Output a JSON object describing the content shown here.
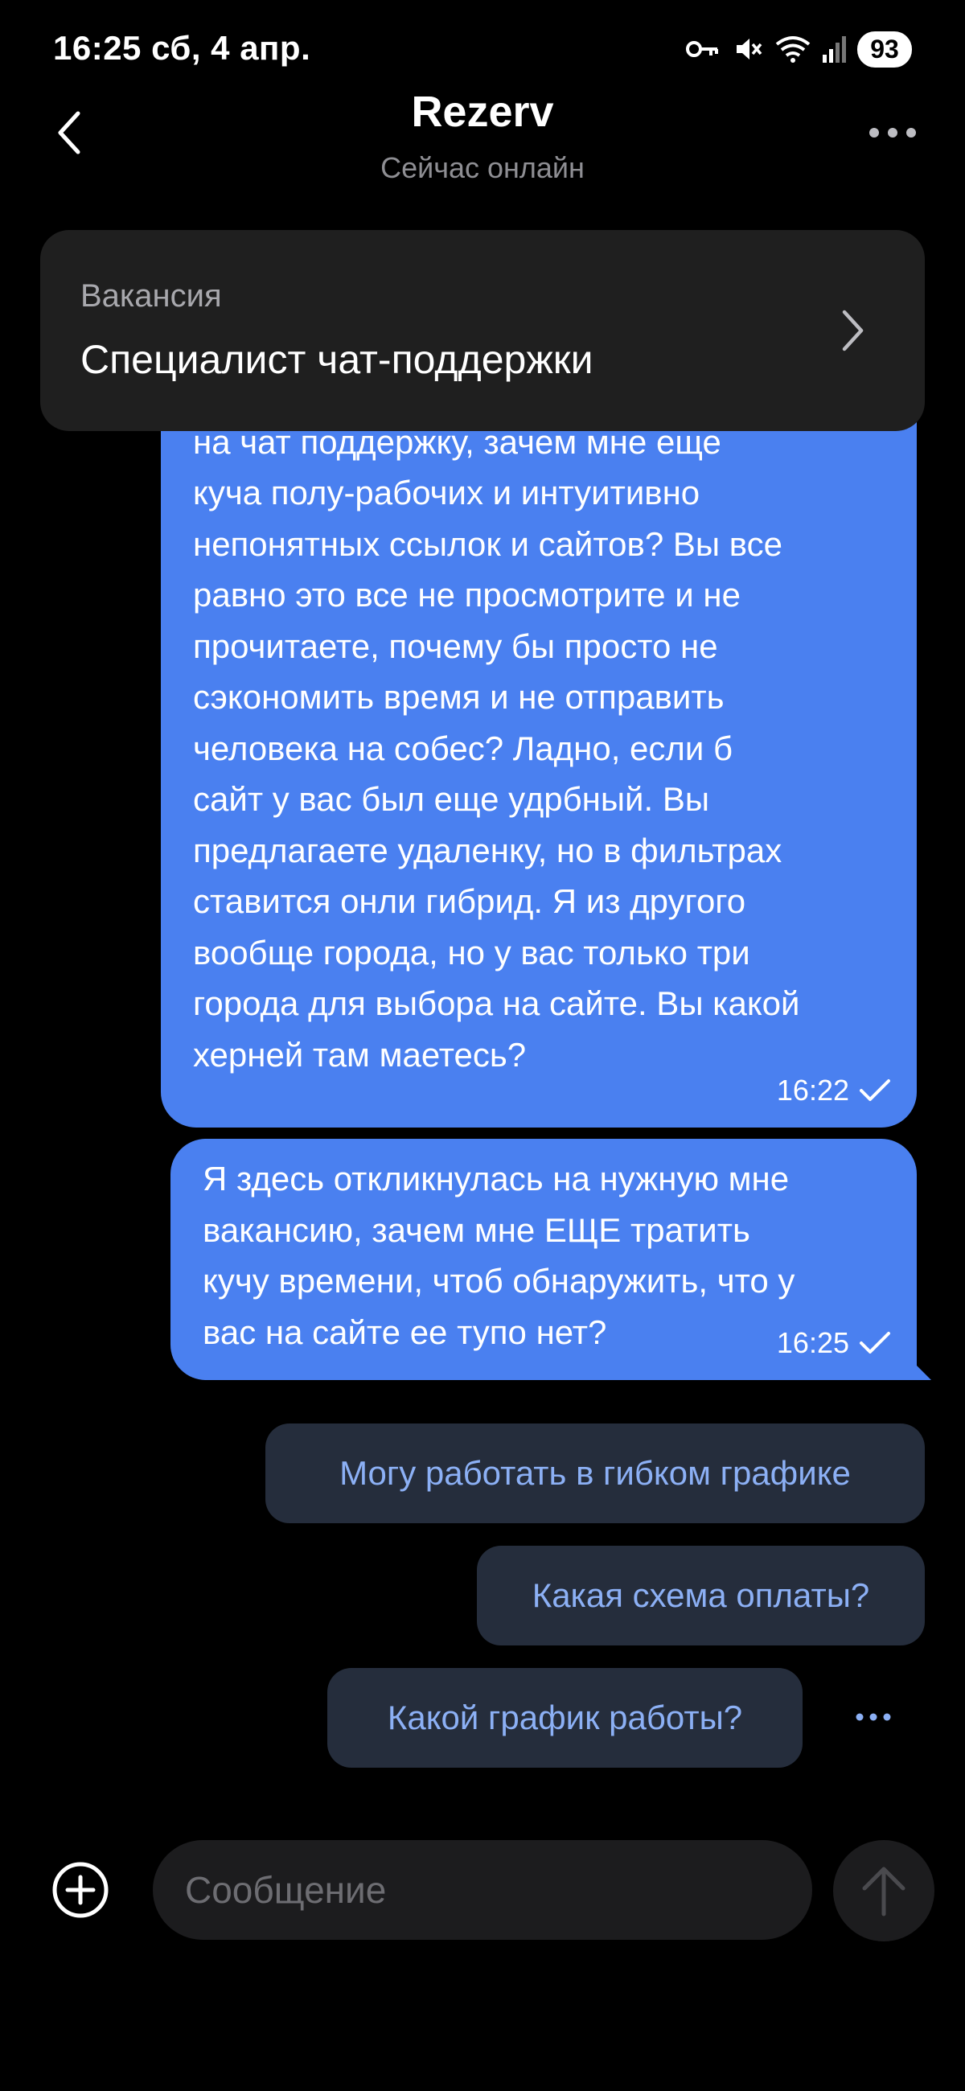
{
  "status_bar": {
    "time_date": "16:25  сб, 4 апр.",
    "battery": "93",
    "icons": [
      "key-icon",
      "mute-icon",
      "wifi-icon",
      "signal-icon",
      "battery-icon"
    ]
  },
  "header": {
    "title": "Rezerv",
    "status": "Сейчас онлайн",
    "back_icon": "chevron-left-icon",
    "more_icon": "more-horizontal-icon"
  },
  "vacancy": {
    "label": "Вакансия",
    "title": "Специалист чат-поддержки",
    "chevron_icon": "chevron-right-icon"
  },
  "messages": [
    {
      "text": "Непрофильное это все. Я откликнулась\nна чат поддержку, зачем мне еще\nкуча полу-рабочих и интуитивно\nнепонятных ссылок и сайтов? Вы все\nравно это все не просмотрите и не\nпрочитаете, почему бы просто не\nсэкономить время и не отправить\nчеловека на собес? Ладно, если б\nсайт у вас был еще удрбный. Вы\nпредлагаете удаленку, но в фильтрах\nставится онли гибрид. Я из другого\nвообще города, но у вас только три\nгорода для выбора на сайте. Вы какой\nхерней там маетесь?",
      "time": "16:22",
      "status_icon": "check-icon"
    },
    {
      "text": "Я здесь откликнулась на нужную мне\nвакансию, зачем мне ЕЩЕ тратить\nкучу времени, чтоб обнаружить, что у\nвас на сайте ее тупо нет?",
      "time": "16:25",
      "status_icon": "check-icon"
    }
  ],
  "quick_replies": [
    "Могу работать в гибком графике",
    "Какая схема оплаты?",
    "Какой график работы?"
  ],
  "composer": {
    "placeholder": "Сообщение",
    "value": "",
    "attach_icon": "plus-circle-icon",
    "send_icon": "arrow-up-icon"
  },
  "colors": {
    "background": "#000000",
    "bubble_outgoing": "#4a80f0",
    "card_background": "#1f1f1f",
    "quick_reply_background": "#252d3c",
    "quick_reply_text": "#8cb0f5",
    "secondary_text": "#8e8e93"
  }
}
